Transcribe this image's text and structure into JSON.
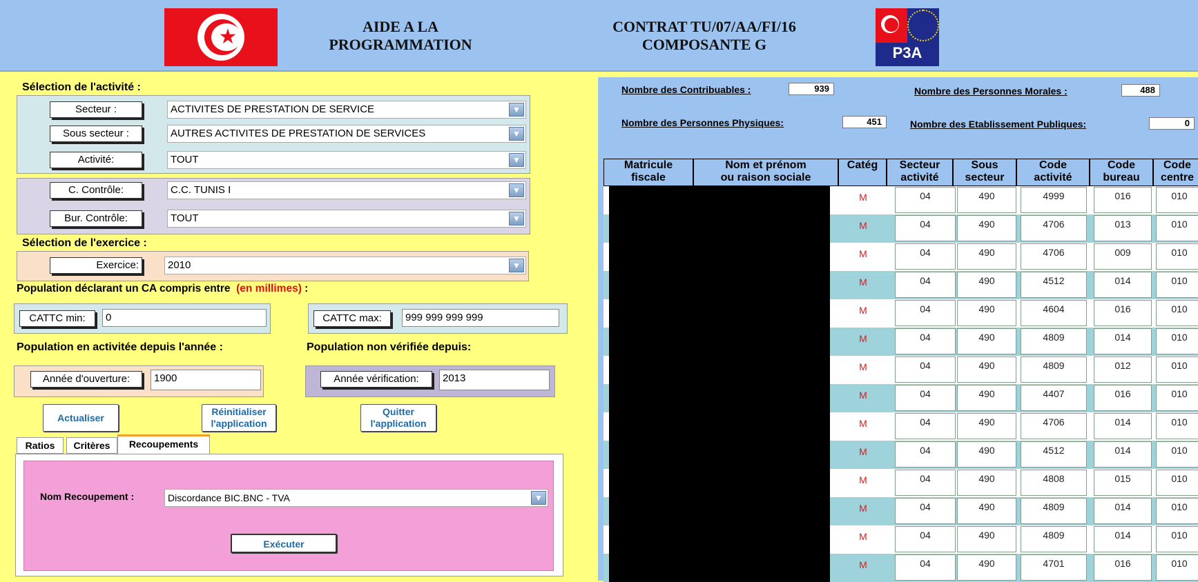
{
  "header": {
    "title_left_line1": "AIDE A LA",
    "title_left_line2": "PROGRAMMATION",
    "title_mid_line1": "CONTRAT TU/07/AA/FI/16",
    "title_mid_line2": "COMPOSANTE G",
    "logo_text": "P3A"
  },
  "activite": {
    "section_label": "Sélection de l'activité :",
    "secteur_label": "Secteur :",
    "secteur_value": "ACTIVITES DE PRESTATION DE SERVICE",
    "sous_secteur_label": "Sous secteur :",
    "sous_secteur_value": "AUTRES ACTIVITES DE PRESTATION DE SERVICES",
    "activite_label": "Activité:",
    "activite_value": "TOUT",
    "cc_label": "C. Contrôle:",
    "cc_value": "C.C. TUNIS I",
    "bur_label": "Bur. Contrôle:",
    "bur_value": "TOUT"
  },
  "exercice": {
    "section_label": "Sélection de l'exercice :",
    "label": "Exercice:",
    "value": "2010"
  },
  "population": {
    "ca_label": "Population déclarant un CA compris entre",
    "ca_unit": "(en millimes)",
    "ca_suffix": ":",
    "min_label": "CATTC min:",
    "min_value": "0",
    "max_label": "CATTC max:",
    "max_value": "999 999 999 999",
    "active_label": "Population en activitée depuis l'année :",
    "nonverif_label": "Population non vérifiée depuis:",
    "annee_ouv_label": "Année d'ouverture:",
    "annee_ouv_value": "1900",
    "annee_verif_label": "Année vérification:",
    "annee_verif_value": "2013"
  },
  "buttons": {
    "actualiser": "Actualiser",
    "reinit_line1": "Réinitialiser",
    "reinit_line2": "l'application",
    "quitter_line1": "Quitter",
    "quitter_line2": "l'application"
  },
  "tabs": [
    "Ratios",
    "Critères",
    "Recoupements"
  ],
  "recoupement": {
    "label": "Nom Recoupement :",
    "value": "Discordance BIC.BNC - TVA",
    "execute": "Exécuter"
  },
  "stats": {
    "contribuables_label": "Nombre des Contribuables :",
    "contribuables_value": "939",
    "morales_label": "Nombre des Personnes Morales :",
    "morales_value": "488",
    "physiques_label": "Nombre des Personnes Physiques:",
    "physiques_value": "451",
    "publiques_label": "Nombre des Etablissement Publiques:",
    "publiques_value": "0"
  },
  "table": {
    "headers": [
      [
        "Matricule",
        "fiscale"
      ],
      [
        "Nom et prénom",
        "ou raison sociale"
      ],
      [
        "Catég",
        ""
      ],
      [
        "Secteur",
        "activité"
      ],
      [
        "Sous",
        "secteur"
      ],
      [
        "Code",
        "activité"
      ],
      [
        "Code",
        "bureau"
      ],
      [
        "Code",
        "centre"
      ]
    ],
    "rows": [
      [
        "M",
        "04",
        "490",
        "4999",
        "016",
        "010"
      ],
      [
        "M",
        "04",
        "490",
        "4706",
        "013",
        "010"
      ],
      [
        "M",
        "04",
        "490",
        "4706",
        "009",
        "010"
      ],
      [
        "M",
        "04",
        "490",
        "4512",
        "014",
        "010"
      ],
      [
        "M",
        "04",
        "490",
        "4604",
        "016",
        "010"
      ],
      [
        "M",
        "04",
        "490",
        "4809",
        "014",
        "010"
      ],
      [
        "M",
        "04",
        "490",
        "4809",
        "012",
        "010"
      ],
      [
        "M",
        "04",
        "490",
        "4407",
        "016",
        "010"
      ],
      [
        "M",
        "04",
        "490",
        "4706",
        "014",
        "010"
      ],
      [
        "M",
        "04",
        "490",
        "4512",
        "014",
        "010"
      ],
      [
        "M",
        "04",
        "490",
        "4808",
        "015",
        "010"
      ],
      [
        "M",
        "04",
        "490",
        "4809",
        "014",
        "010"
      ],
      [
        "M",
        "04",
        "490",
        "4809",
        "014",
        "010"
      ],
      [
        "M",
        "04",
        "490",
        "4701",
        "016",
        "010"
      ]
    ]
  },
  "colors": {
    "page_bg": "#ffff80",
    "header_bg": "#9cc3f0",
    "row_even": "#9ed3dc",
    "row_odd": "#ffffff"
  }
}
